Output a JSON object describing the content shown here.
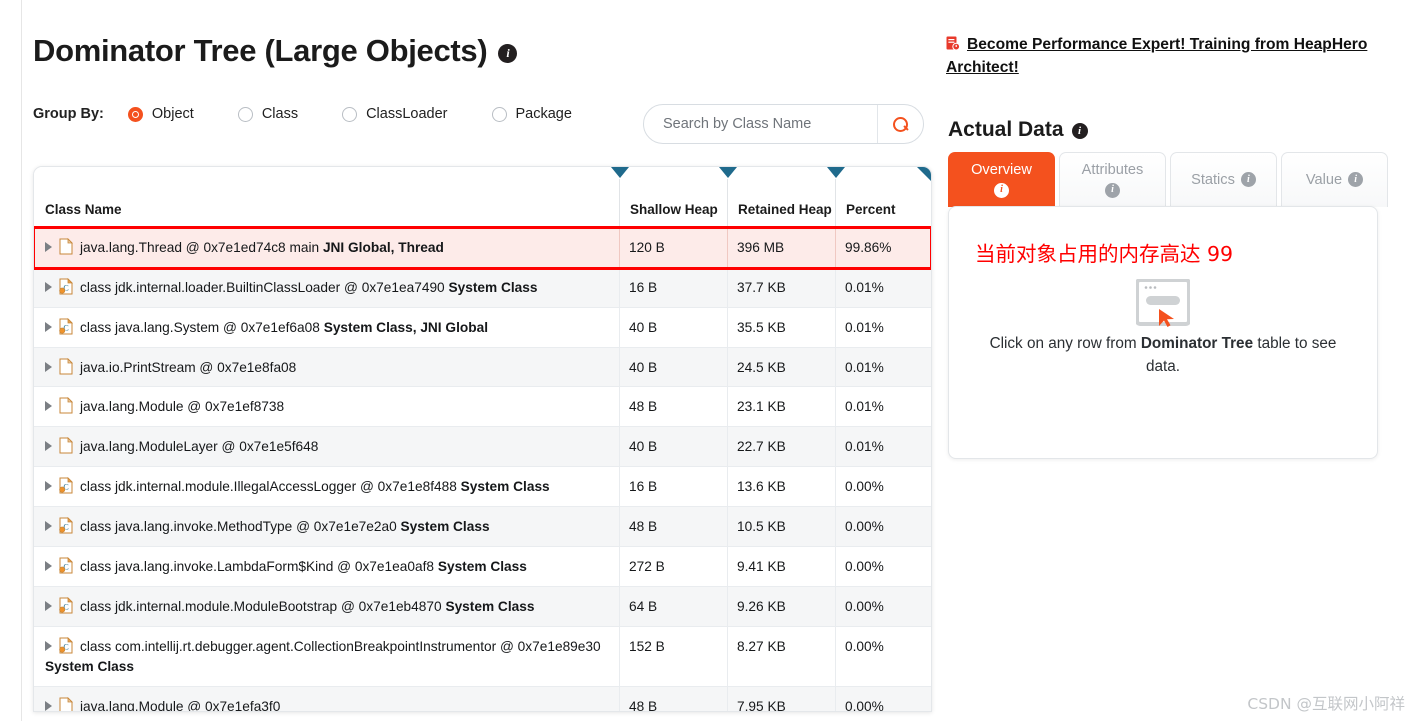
{
  "header": {
    "title": "Dominator Tree (Large Objects)",
    "title_info_icon": "info-icon"
  },
  "group_by": {
    "label": "Group By:",
    "options": [
      {
        "label": "Object",
        "checked": true
      },
      {
        "label": "Class",
        "checked": false
      },
      {
        "label": "ClassLoader",
        "checked": false
      },
      {
        "label": "Package",
        "checked": false
      }
    ]
  },
  "search": {
    "placeholder": "Search by Class Name",
    "value": "",
    "icon": "search-icon"
  },
  "table": {
    "columns": [
      "Class Name",
      "Shallow Heap",
      "Retained Heap",
      "Percent"
    ],
    "rows": [
      {
        "icon": "object-file-icon",
        "name": "java.lang.Thread @ 0x7e1ed74c8 main ",
        "name_bold": "JNI Global, Thread",
        "shallow_heap": "120 B",
        "retained_heap": "396 MB",
        "percent": "99.86%",
        "selected": true
      },
      {
        "icon": "class-file-icon",
        "name": "class jdk.internal.loader.BuiltinClassLoader @ 0x7e1ea7490 ",
        "name_bold": "System Class",
        "shallow_heap": "16 B",
        "retained_heap": "37.7 KB",
        "percent": "0.01%"
      },
      {
        "icon": "class-file-icon",
        "name": "class java.lang.System @ 0x7e1ef6a08 ",
        "name_bold": "System Class, JNI Global",
        "shallow_heap": "40 B",
        "retained_heap": "35.5 KB",
        "percent": "0.01%"
      },
      {
        "icon": "object-file-icon",
        "name": "java.io.PrintStream @ 0x7e1e8fa08",
        "name_bold": "",
        "shallow_heap": "40 B",
        "retained_heap": "24.5 KB",
        "percent": "0.01%"
      },
      {
        "icon": "object-file-icon",
        "name": "java.lang.Module @ 0x7e1ef8738",
        "name_bold": "",
        "shallow_heap": "48 B",
        "retained_heap": "23.1 KB",
        "percent": "0.01%"
      },
      {
        "icon": "object-file-icon",
        "name": "java.lang.ModuleLayer @ 0x7e1e5f648",
        "name_bold": "",
        "shallow_heap": "40 B",
        "retained_heap": "22.7 KB",
        "percent": "0.01%"
      },
      {
        "icon": "class-file-icon",
        "name": "class jdk.internal.module.IllegalAccessLogger @ 0x7e1e8f488 ",
        "name_bold": "System Class",
        "shallow_heap": "16 B",
        "retained_heap": "13.6 KB",
        "percent": "0.00%"
      },
      {
        "icon": "class-file-icon",
        "name": "class java.lang.invoke.MethodType @ 0x7e1e7e2a0 ",
        "name_bold": "System Class",
        "shallow_heap": "48 B",
        "retained_heap": "10.5 KB",
        "percent": "0.00%"
      },
      {
        "icon": "class-file-icon",
        "name": "class java.lang.invoke.LambdaForm$Kind @ 0x7e1ea0af8 ",
        "name_bold": "System Class",
        "shallow_heap": "272 B",
        "retained_heap": "9.41 KB",
        "percent": "0.00%"
      },
      {
        "icon": "class-file-icon",
        "name": "class jdk.internal.module.ModuleBootstrap @ 0x7e1eb4870 ",
        "name_bold": "System Class",
        "shallow_heap": "64 B",
        "retained_heap": "9.26 KB",
        "percent": "0.00%"
      },
      {
        "icon": "class-file-icon",
        "name": "class com.intellij.rt.debugger.agent.CollectionBreakpointInstrumentor @ 0x7e1e89e30",
        "name_bold": "",
        "overflow_text": "System Class",
        "shallow_heap": "152 B",
        "retained_heap": "8.27 KB",
        "percent": "0.00%"
      },
      {
        "icon": "object-file-icon",
        "name": "java.lang.Module @ 0x7e1efa3f0",
        "name_bold": "",
        "shallow_heap": "48 B",
        "retained_heap": "7.95 KB",
        "percent": "0.00%"
      }
    ]
  },
  "sidebar": {
    "promo_link": "Become Performance Expert! Training from HeapHero Architect!",
    "promo_icon": "report-icon",
    "actual_data_title": "Actual Data",
    "tabs": [
      {
        "label": "Overview",
        "active": true,
        "info_inline": false
      },
      {
        "label": "Attributes",
        "active": false,
        "info_inline": false
      },
      {
        "label": "Statics",
        "active": false,
        "info_inline": true
      },
      {
        "label": "Value",
        "active": false,
        "info_inline": true
      }
    ],
    "panel": {
      "annotation": "当前对象占用的内存高达 99",
      "placeholder_icon": "click-window-icon",
      "hint_prefix": "Click on any row from ",
      "hint_bold": "Dominator Tree",
      "hint_suffix": " table to see data."
    }
  },
  "watermark": "CSDN @互联网小阿祥",
  "colors": {
    "accent": "#f4511e",
    "selected_row_bg": "#fdebe9",
    "selected_row_border": "#ff0000",
    "annotation_red": "#ff0000",
    "header_triangle": "#1f6a8c"
  }
}
